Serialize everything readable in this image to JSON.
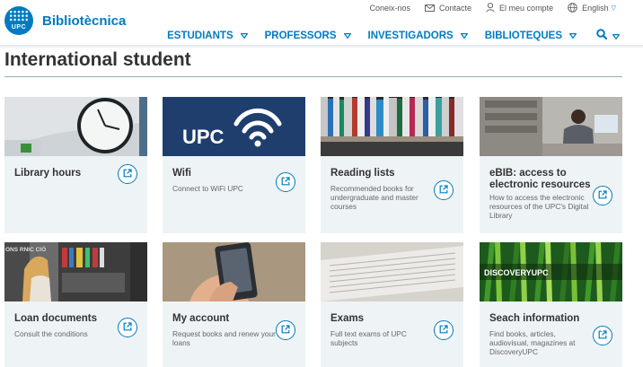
{
  "header": {
    "logo_label": "UPC",
    "logo_text": "Bibliotècnica",
    "utility": {
      "about": "Coneix-nos",
      "contact": "Contacte",
      "account": "El meu compte",
      "language": "English"
    },
    "nav": {
      "students": "ESTUDIANTS",
      "teachers": "PROFESSORS",
      "researchers": "INVESTIGADORS",
      "libraries": "BIBLIOTEQUES"
    }
  },
  "page": {
    "title": "International student"
  },
  "cards": [
    {
      "title": "Library hours",
      "desc": "",
      "image": "wall-clock"
    },
    {
      "title": "Wifi",
      "desc": "Connect to WiFi UPC",
      "image": "upc-wifi-logo",
      "image_text": "UPC"
    },
    {
      "title": "Reading lists",
      "desc": "Recommended books for undergraduate and master courses",
      "image": "bookshelf"
    },
    {
      "title": "eBIB: access to electronic resources",
      "desc": "How to access the electronic resources of the UPC's Digital Library",
      "image": "person-at-computer"
    },
    {
      "title": "Loan documents",
      "desc": "Consult the conditions",
      "image": "student-at-shelves",
      "image_text": "ONS RNIC CIÓ"
    },
    {
      "title": "My account",
      "desc": "Request books and renew your loans",
      "image": "hand-with-phone"
    },
    {
      "title": "Exams",
      "desc": "Full text exams of UPC subjects",
      "image": "exam-papers"
    },
    {
      "title": "Seach information",
      "desc": "Find books, articles, audiovisual, magazines at DiscoveryUPC",
      "image": "discoveryupc-banner",
      "image_text": "DISCOVERYUPC"
    }
  ],
  "colors": {
    "brand_blue": "#007bc0",
    "card_bg": "#eef3f6",
    "title_rule": "#8fb0ad"
  }
}
